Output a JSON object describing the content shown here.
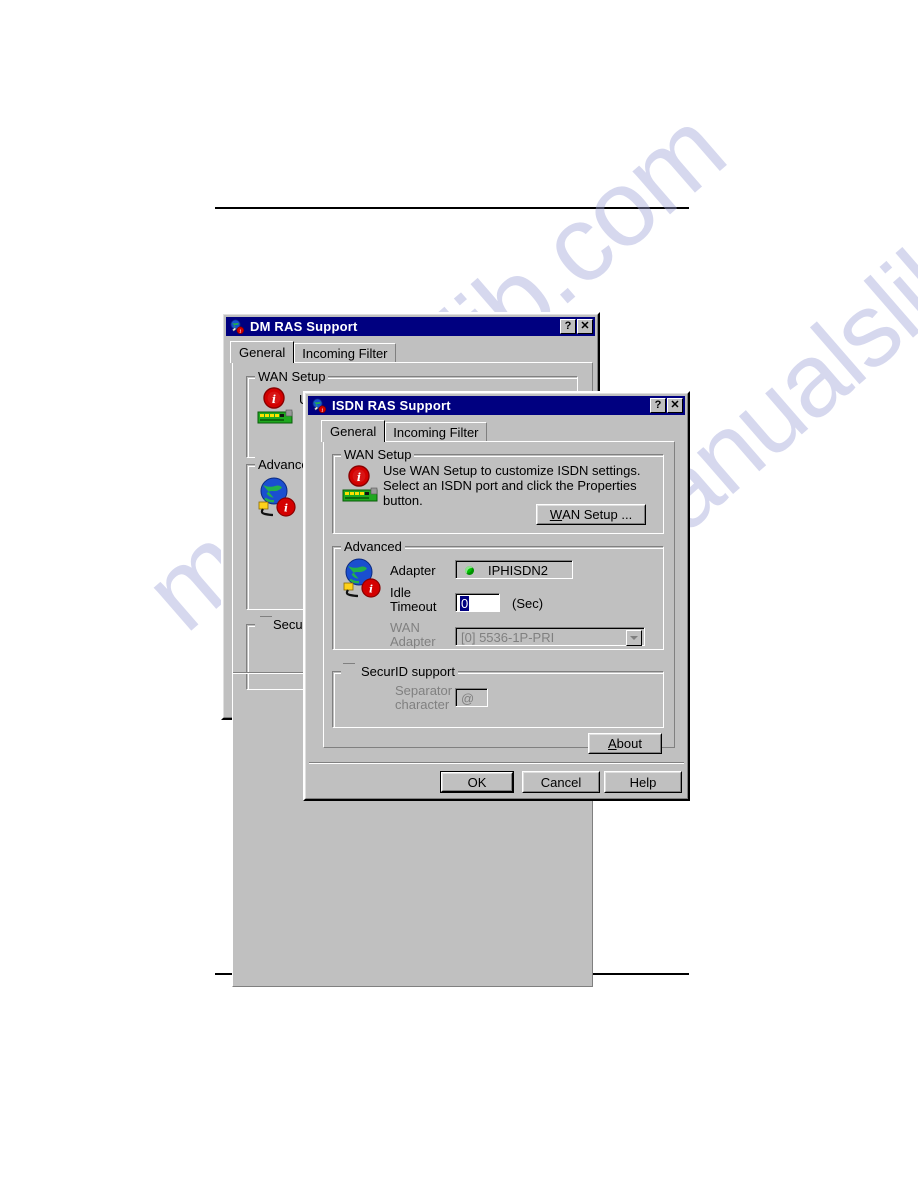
{
  "page": {
    "watermark_text": "manualslib.com"
  },
  "back_dialog": {
    "title": "DM RAS Support",
    "icon": "globe-network-icon",
    "titlebar_buttons": [
      {
        "name": "help-button",
        "glyph": "?"
      },
      {
        "name": "close-button",
        "glyph": "✕"
      }
    ],
    "tabs": [
      {
        "label": "General",
        "active": true
      },
      {
        "label": "Incoming Filter",
        "active": false
      }
    ],
    "wan_setup": {
      "legend": "WAN Setup",
      "icon": "isdn-card-info-icon",
      "description": "Use WAN Setup to customize ISDN settings."
    },
    "advanced": {
      "legend": "Advanced",
      "icon": "globe-modem-info-icon"
    },
    "securid": {
      "legend": "SecurID support"
    }
  },
  "front_dialog": {
    "title": "ISDN RAS Support",
    "icon": "globe-network-icon",
    "titlebar_buttons": [
      {
        "name": "help-button",
        "glyph": "?"
      },
      {
        "name": "close-button",
        "glyph": "✕"
      }
    ],
    "tabs": [
      {
        "label": "General",
        "active": true
      },
      {
        "label": "Incoming Filter",
        "active": false
      }
    ],
    "wan_setup": {
      "legend": "WAN Setup",
      "icon": "isdn-card-info-icon",
      "description": "Use WAN Setup to customize ISDN settings.\nSelect an ISDN port and click the Properties\nbutton.",
      "button": {
        "prefix": "W",
        "rest": "AN Setup ..."
      }
    },
    "advanced": {
      "legend": "Advanced",
      "icon": "globe-modem-info-icon",
      "adapter_label": "Adapter",
      "adapter_value": "IPHISDN2",
      "adapter_status_color": "#00c000",
      "idle_timeout_label": "Idle\nTimeout",
      "idle_timeout_value": "0",
      "idle_timeout_unit": "(Sec)",
      "wan_adapter_label": "WAN\nAdapter",
      "wan_adapter_value": "[0] 5536-1P-PRI",
      "wan_adapter_enabled": false
    },
    "securid": {
      "legend": "SecurID support",
      "checked": false,
      "separator_label": "Separator\ncharacter",
      "separator_value": "@",
      "enabled": false
    },
    "about_button": {
      "prefix": "A",
      "rest": "bout"
    },
    "footer_buttons": [
      {
        "name": "ok-button",
        "label": "OK",
        "default": true
      },
      {
        "name": "cancel-button",
        "label": "Cancel",
        "default": false
      },
      {
        "name": "help-button",
        "label": "Help",
        "default": false
      }
    ]
  }
}
